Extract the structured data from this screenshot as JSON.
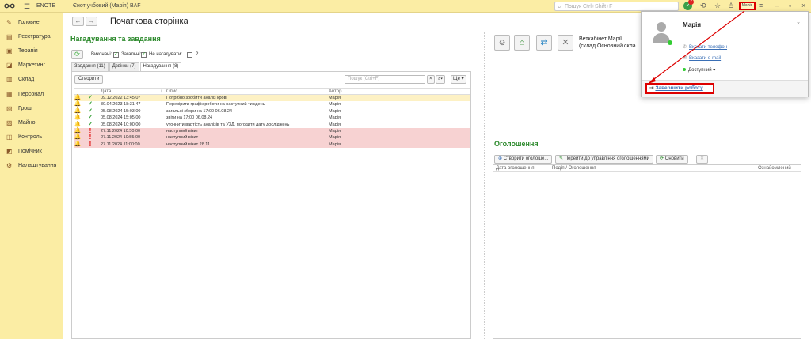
{
  "topbar": {
    "app_name": "ENOTE",
    "db_name": "Єнот учбовий (Марія) BAF",
    "search_placeholder": "Пошук Ctrl+Shift+F",
    "notification_count": "2",
    "user_short": "Марія"
  },
  "sidebar": {
    "items": [
      {
        "label": "Головне",
        "icon": "pencil-icon"
      },
      {
        "label": "Реєстратура",
        "icon": "register-icon"
      },
      {
        "label": "Терапія",
        "icon": "therapy-icon"
      },
      {
        "label": "Маркетинг",
        "icon": "marketing-icon"
      },
      {
        "label": "Склад",
        "icon": "warehouse-icon"
      },
      {
        "label": "Персонал",
        "icon": "staff-icon"
      },
      {
        "label": "Гроші",
        "icon": "money-icon"
      },
      {
        "label": "Майно",
        "icon": "property-icon"
      },
      {
        "label": "Контроль",
        "icon": "control-icon"
      },
      {
        "label": "Помічник",
        "icon": "assistant-icon"
      },
      {
        "label": "Налаштування",
        "icon": "settings-icon"
      }
    ]
  },
  "page": {
    "title": "Початкова сторінка"
  },
  "reminders": {
    "title": "Нагадування та завдання",
    "filter_done": "Виконані:",
    "filter_general": "Загальні:",
    "filter_no_remind": "Не нагадувати:",
    "filter_help": "?",
    "tabs": [
      "Завдання (11)",
      "Дзвінки (7)",
      "Нагадування (8)"
    ],
    "create_label": "Створити",
    "search_placeholder": "Пошук (Ctrl+F)",
    "more_label": "Ще",
    "columns": {
      "date": "Дата",
      "sort": "↓",
      "description": "Опис",
      "author": "Автор"
    },
    "rows": [
      {
        "status": "done",
        "date": "09.12.2022 13:45:07",
        "description": "Потрібно зробити аналіз крові",
        "author": "Марія"
      },
      {
        "status": "done",
        "date": "30.04.2023 18:31:47",
        "description": "Перевірити графік роботи на наступний тиждень",
        "author": "Марія"
      },
      {
        "status": "done",
        "date": "05.08.2024 15:03:00",
        "description": "загальні збори на 17:00 06.08.24",
        "author": "Марія"
      },
      {
        "status": "done",
        "date": "05.08.2024 15:05:00",
        "description": "звіти на 17:00 06.08.24",
        "author": "Марія"
      },
      {
        "status": "done",
        "date": "05.08.2024 10:00:00",
        "description": "уточнити вартість аналізів та УЗД, погодити дату досліджень",
        "author": "Марія"
      },
      {
        "status": "overdue",
        "date": "27.11.2024 10:50:00",
        "description": "наступний візит",
        "author": "Марія"
      },
      {
        "status": "overdue",
        "date": "27.11.2024 10:55:00",
        "description": "наступний візит",
        "author": "Марія"
      },
      {
        "status": "overdue",
        "date": "27.11.2024 11:00:00",
        "description": "наступний візит 28.11",
        "author": "Марія"
      }
    ]
  },
  "vet": {
    "line1": "Веткабінет Марії",
    "line2": "(склад Основний скла"
  },
  "announcements": {
    "title": "Оголошення",
    "create_label": "Створити оголоше...",
    "manage_label": "Перейти до управління оголошеннями",
    "refresh_label": "Оновити",
    "columns": {
      "date": "Дата оголошення",
      "event": "Подія / Оголошення",
      "read": "Ознайомлений"
    }
  },
  "user_menu": {
    "name": "Марія",
    "close": "×",
    "phone_link": "Вказати телефон",
    "email_link": "Вказати e-mail",
    "status": "Доступний",
    "status_arrow": "▾",
    "end_work": "Завершити роботу"
  },
  "colors": {
    "sidebar_bg": "#fbeda4",
    "section_title": "#2d8a2d",
    "highlight": "#dd0000",
    "overdue_row": "#f7d2d2"
  }
}
